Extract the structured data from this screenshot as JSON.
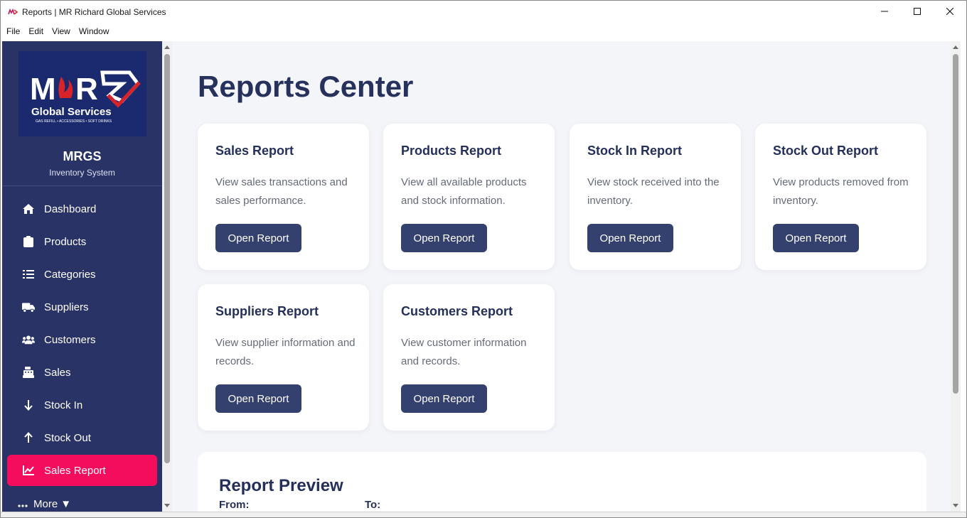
{
  "window": {
    "title": "Reports | MR Richard Global Services",
    "controls": {
      "minimize_icon": "minimize-icon",
      "maximize_icon": "maximize-icon",
      "close_icon": "close-icon"
    }
  },
  "menubar": {
    "items": [
      "File",
      "Edit",
      "View",
      "Window"
    ]
  },
  "sidebar": {
    "logo": {
      "main": "MR",
      "line1": "Global Services",
      "line2": "GAS REFILL • ACCESSORIES • SOFT DRINKS"
    },
    "brand_name": "MRGS",
    "brand_sub": "Inventory System",
    "items": [
      {
        "label": "Dashboard",
        "icon": "home-icon"
      },
      {
        "label": "Products",
        "icon": "box-icon"
      },
      {
        "label": "Categories",
        "icon": "list-icon"
      },
      {
        "label": "Suppliers",
        "icon": "truck-icon"
      },
      {
        "label": "Customers",
        "icon": "users-icon"
      },
      {
        "label": "Sales",
        "icon": "cash-register-icon"
      },
      {
        "label": "Stock In",
        "icon": "arrow-down-icon"
      },
      {
        "label": "Stock Out",
        "icon": "arrow-up-icon"
      },
      {
        "label": "Sales Report",
        "icon": "chart-line-icon",
        "active": true
      }
    ],
    "more_label": "More",
    "more_caret": "▼",
    "active_color": "#f40d5d",
    "bg_color": "#293366"
  },
  "main": {
    "page_title": "Reports Center",
    "cards": [
      {
        "title": "Sales Report",
        "desc": "View sales transactions and sales performance.",
        "button": "Open Report"
      },
      {
        "title": "Products Report",
        "desc": "View all available products and stock information.",
        "button": "Open Report"
      },
      {
        "title": "Stock In Report",
        "desc": "View stock received into the inventory.",
        "button": "Open Report"
      },
      {
        "title": "Stock Out Report",
        "desc": "View products removed from inventory.",
        "button": "Open Report"
      },
      {
        "title": "Suppliers Report",
        "desc": "View supplier information and records.",
        "button": "Open Report"
      },
      {
        "title": "Customers Report",
        "desc": "View customer information and records.",
        "button": "Open Report"
      }
    ],
    "preview": {
      "title": "Report Preview",
      "from_label": "From:",
      "to_label": "To:"
    },
    "button_color": "#34406e",
    "title_color": "#27325c"
  }
}
